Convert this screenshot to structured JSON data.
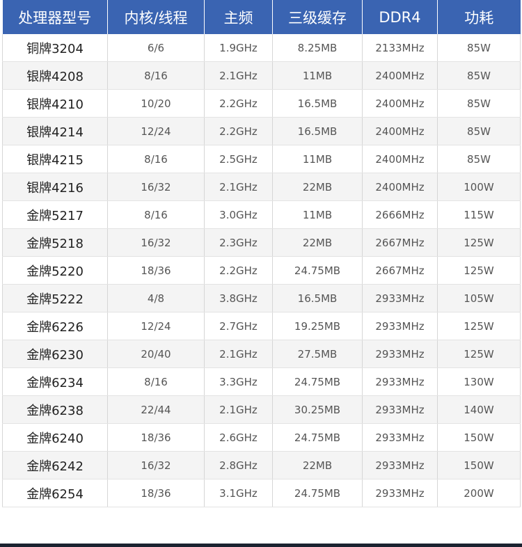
{
  "header": {
    "model": "处理器型号",
    "cores_threads": "内核/线程",
    "frequency": "主频",
    "l3_cache": "三级缓存",
    "memory": "DDR4",
    "power": "功耗"
  },
  "rows": [
    {
      "model": "铜牌3204",
      "cores_threads": "6/6",
      "frequency": "1.9GHz",
      "l3_cache": "8.25MB",
      "memory": "2133MHz",
      "power": "85W"
    },
    {
      "model": "银牌4208",
      "cores_threads": "8/16",
      "frequency": "2.1GHz",
      "l3_cache": "11MB",
      "memory": "2400MHz",
      "power": "85W"
    },
    {
      "model": "银牌4210",
      "cores_threads": "10/20",
      "frequency": "2.2GHz",
      "l3_cache": "16.5MB",
      "memory": "2400MHz",
      "power": "85W"
    },
    {
      "model": "银牌4214",
      "cores_threads": "12/24",
      "frequency": "2.2GHz",
      "l3_cache": "16.5MB",
      "memory": "2400MHz",
      "power": "85W"
    },
    {
      "model": "银牌4215",
      "cores_threads": "8/16",
      "frequency": "2.5GHz",
      "l3_cache": "11MB",
      "memory": "2400MHz",
      "power": "85W"
    },
    {
      "model": "银牌4216",
      "cores_threads": "16/32",
      "frequency": "2.1GHz",
      "l3_cache": "22MB",
      "memory": "2400MHz",
      "power": "100W"
    },
    {
      "model": "金牌5217",
      "cores_threads": "8/16",
      "frequency": "3.0GHz",
      "l3_cache": "11MB",
      "memory": "2666MHz",
      "power": "115W"
    },
    {
      "model": "金牌5218",
      "cores_threads": "16/32",
      "frequency": "2.3GHz",
      "l3_cache": "22MB",
      "memory": "2667MHz",
      "power": "125W"
    },
    {
      "model": "金牌5220",
      "cores_threads": "18/36",
      "frequency": "2.2GHz",
      "l3_cache": "24.75MB",
      "memory": "2667MHz",
      "power": "125W"
    },
    {
      "model": "金牌5222",
      "cores_threads": "4/8",
      "frequency": "3.8GHz",
      "l3_cache": "16.5MB",
      "memory": "2933MHz",
      "power": "105W"
    },
    {
      "model": "金牌6226",
      "cores_threads": "12/24",
      "frequency": "2.7GHz",
      "l3_cache": "19.25MB",
      "memory": "2933MHz",
      "power": "125W"
    },
    {
      "model": "金牌6230",
      "cores_threads": "20/40",
      "frequency": "2.1GHz",
      "l3_cache": "27.5MB",
      "memory": "2933MHz",
      "power": "125W"
    },
    {
      "model": "金牌6234",
      "cores_threads": "8/16",
      "frequency": "3.3GHz",
      "l3_cache": "24.75MB",
      "memory": "2933MHz",
      "power": "130W"
    },
    {
      "model": "金牌6238",
      "cores_threads": "22/44",
      "frequency": "2.1GHz",
      "l3_cache": "30.25MB",
      "memory": "2933MHz",
      "power": "140W"
    },
    {
      "model": "金牌6240",
      "cores_threads": "18/36",
      "frequency": "2.6GHz",
      "l3_cache": "24.75MB",
      "memory": "2933MHz",
      "power": "150W"
    },
    {
      "model": "金牌6242",
      "cores_threads": "16/32",
      "frequency": "2.8GHz",
      "l3_cache": "22MB",
      "memory": "2933MHz",
      "power": "150W"
    },
    {
      "model": "金牌6254",
      "cores_threads": "18/36",
      "frequency": "3.1GHz",
      "l3_cache": "24.75MB",
      "memory": "2933MHz",
      "power": "200W"
    }
  ],
  "colors": {
    "header_background": "#3a64b2",
    "header_text": "#ffffff",
    "stripe": "#f4f4f4",
    "bottom_rule": "#1b2230"
  }
}
